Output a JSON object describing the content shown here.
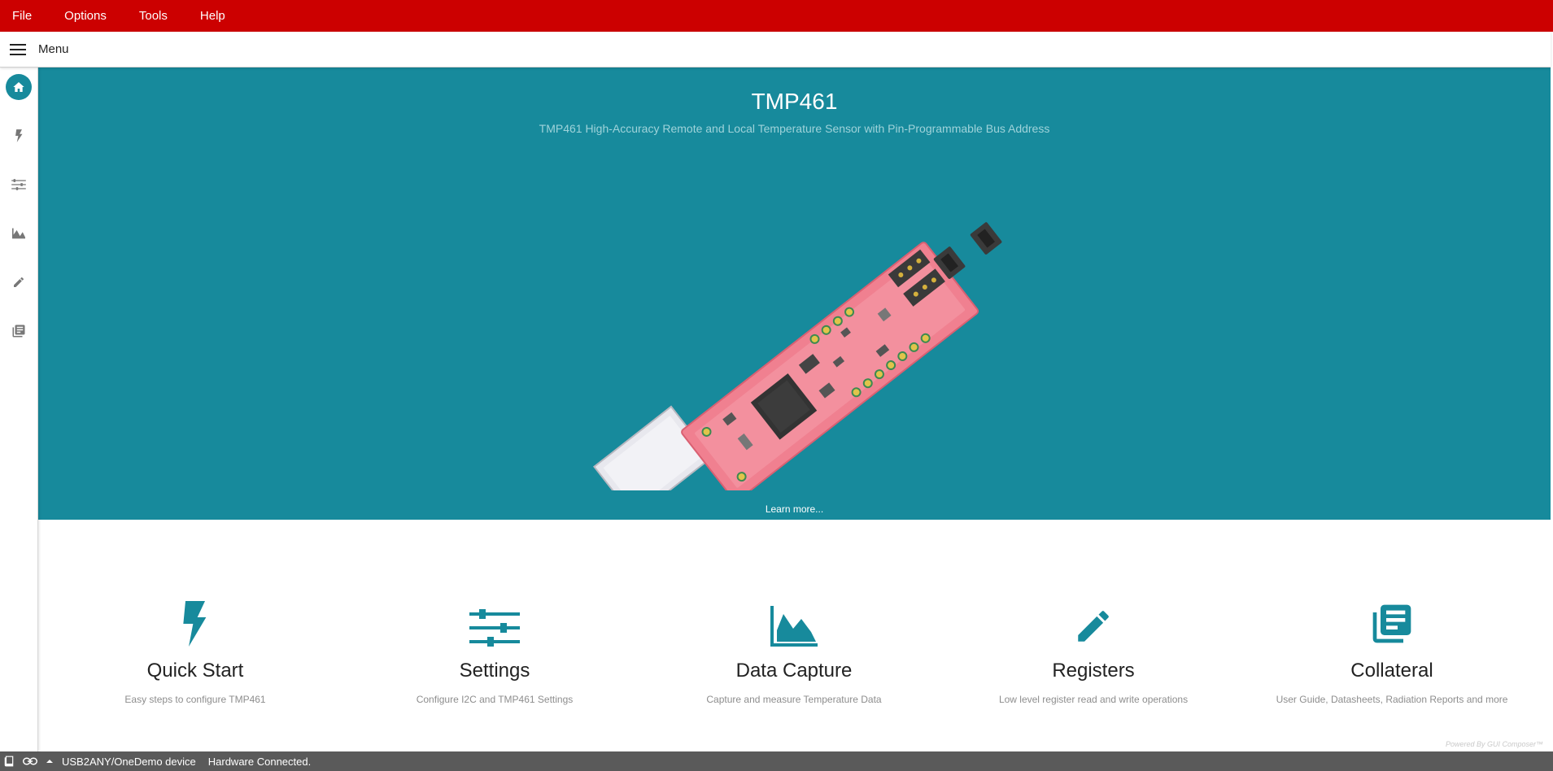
{
  "menubar": {
    "items": [
      "File",
      "Options",
      "Tools",
      "Help"
    ]
  },
  "toolbar": {
    "menu_label": "Menu"
  },
  "rail": {
    "icons": [
      "home-icon",
      "lightning-icon",
      "sliders-icon",
      "area-chart-icon",
      "pencil-icon",
      "collateral-icon"
    ]
  },
  "hero": {
    "title": "TMP461",
    "subtitle": "TMP461 High-Accuracy Remote and Local Temperature Sensor with Pin-Programmable Bus Address",
    "learn_more": "Learn more..."
  },
  "cards": [
    {
      "icon": "lightning-icon",
      "title": "Quick Start",
      "desc": "Easy steps to configure TMP461"
    },
    {
      "icon": "sliders-icon",
      "title": "Settings",
      "desc": "Configure I2C and TMP461 Settings"
    },
    {
      "icon": "area-chart-icon",
      "title": "Data Capture",
      "desc": "Capture and measure Temperature Data"
    },
    {
      "icon": "pencil-icon",
      "title": "Registers",
      "desc": "Low level register read and write operations"
    },
    {
      "icon": "collateral-icon",
      "title": "Collateral",
      "desc": "User Guide, Datasheets, Radiation Reports and more"
    }
  ],
  "footer": {
    "powered_by": "Powered By GUI Composer™"
  },
  "statusbar": {
    "device": "USB2ANY/OneDemo device",
    "status": "Hardware Connected."
  },
  "colors": {
    "menubar": "#cc0000",
    "accent": "#178a9c",
    "statusbar": "#5a5a5a"
  }
}
